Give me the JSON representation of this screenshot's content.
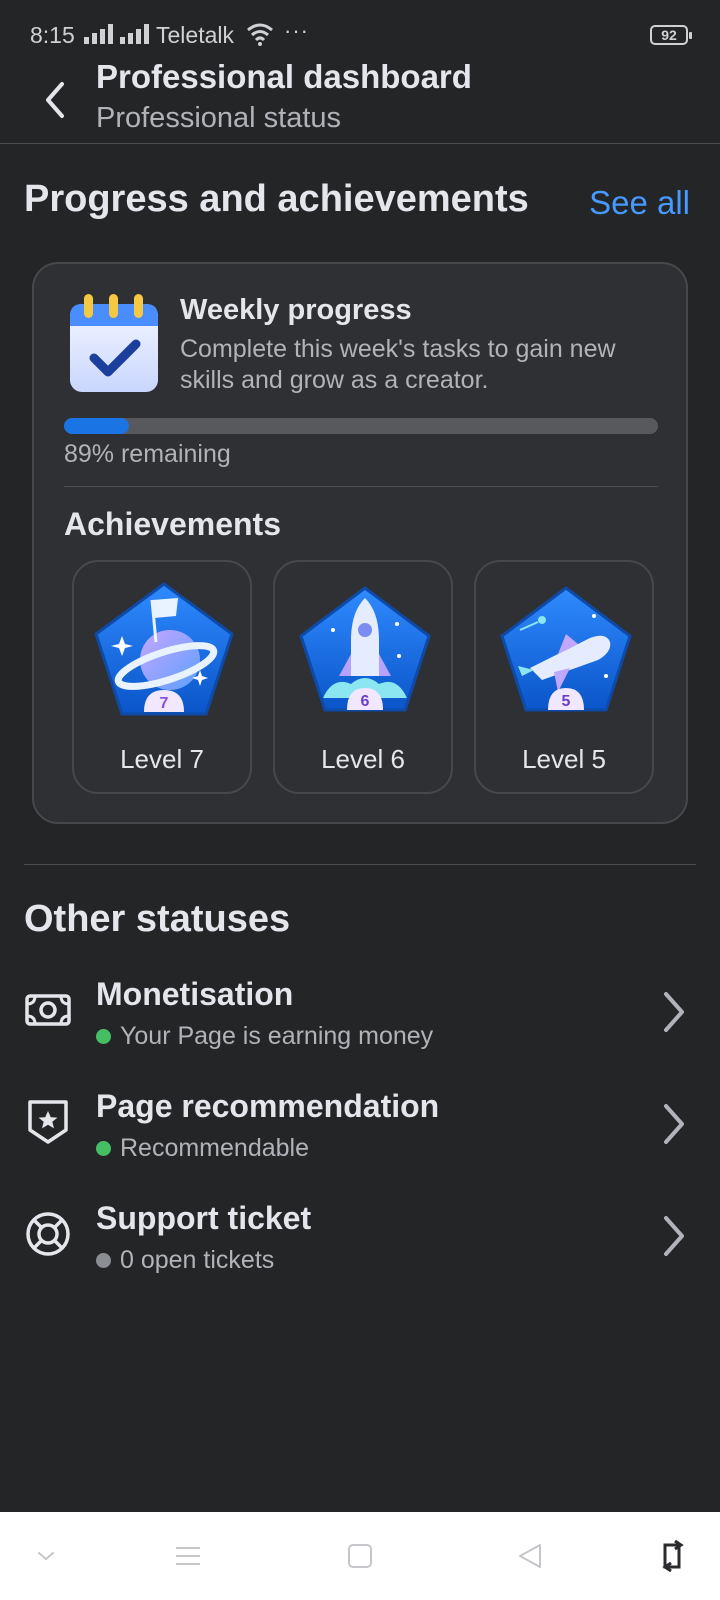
{
  "status_bar": {
    "time": "8:15",
    "carrier": "Teletalk",
    "more": "···",
    "battery": "92"
  },
  "header": {
    "title": "Professional dashboard",
    "subtitle": "Professional status"
  },
  "progress_section": {
    "title": "Progress and achievements",
    "see_all": "See all",
    "weekly": {
      "title": "Weekly progress",
      "description": "Complete this week's tasks to gain new skills and grow as a creator.",
      "progress_fraction": 0.11,
      "remaining_text": "89% remaining"
    },
    "achievements_title": "Achievements",
    "badges": [
      {
        "label": "Level 7",
        "number": "7"
      },
      {
        "label": "Level 6",
        "number": "6"
      },
      {
        "label": "Level 5",
        "number": "5"
      }
    ]
  },
  "other_statuses": {
    "title": "Other statuses",
    "items": [
      {
        "title": "Monetisation",
        "status": "Your Page is earning money",
        "dot_color": "#45bd62",
        "icon": "money-icon"
      },
      {
        "title": "Page recommendation",
        "status": "Recommendable",
        "dot_color": "#45bd62",
        "icon": "shield-star-icon"
      },
      {
        "title": "Support ticket",
        "status": "0 open tickets",
        "dot_color": "#8a8d91",
        "icon": "lifebuoy-icon"
      }
    ]
  },
  "colors": {
    "accent": "#4599ff",
    "progress": "#1b74e4",
    "background": "#242527",
    "card": "#2f3033"
  }
}
